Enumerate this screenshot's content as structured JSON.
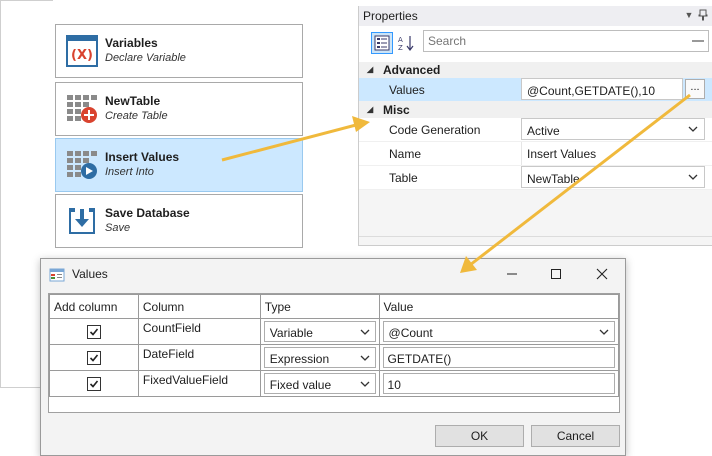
{
  "workflow": {
    "items": [
      {
        "name": "Variables",
        "subtitle": "Declare Variable",
        "icon": "variables-icon",
        "selected": false
      },
      {
        "name": "NewTable",
        "subtitle": "Create Table",
        "icon": "create-table-icon",
        "selected": false
      },
      {
        "name": "Insert Values",
        "subtitle": "Insert Into",
        "icon": "insert-into-icon",
        "selected": true
      },
      {
        "name": "Save Database",
        "subtitle": "Save",
        "icon": "save-database-icon",
        "selected": false
      }
    ]
  },
  "properties": {
    "title": "Properties",
    "search_placeholder": "Search",
    "categories": [
      {
        "label": "Advanced",
        "rows": [
          {
            "name": "Values",
            "value": "@Count,GETDATE(),10",
            "editor": "ellipsis",
            "ellipsis_label": "...",
            "selected": true
          }
        ]
      },
      {
        "label": "Misc",
        "rows": [
          {
            "name": "Code Generation",
            "value": "Active",
            "editor": "dropdown"
          },
          {
            "name": "Name",
            "value": "Insert Values",
            "editor": "text"
          },
          {
            "name": "Table",
            "value": "NewTable",
            "editor": "dropdown"
          }
        ]
      }
    ]
  },
  "dialog": {
    "title": "Values",
    "columns": [
      "Add column",
      "Column",
      "Type",
      "Value"
    ],
    "rows": [
      {
        "checked": true,
        "column": "CountField",
        "type": "Variable",
        "value": "@Count",
        "value_editor": "dropdown"
      },
      {
        "checked": true,
        "column": "DateField",
        "type": "Expression",
        "value": "GETDATE()",
        "value_editor": "text"
      },
      {
        "checked": true,
        "column": "FixedValueField",
        "type": "Fixed value",
        "value": "10",
        "value_editor": "text"
      }
    ],
    "ok_label": "OK",
    "cancel_label": "Cancel"
  },
  "colors": {
    "selection": "#cce8ff",
    "arrow": "#f0b93c",
    "icon_blue": "#2e6da4",
    "icon_red": "#d9432f"
  }
}
